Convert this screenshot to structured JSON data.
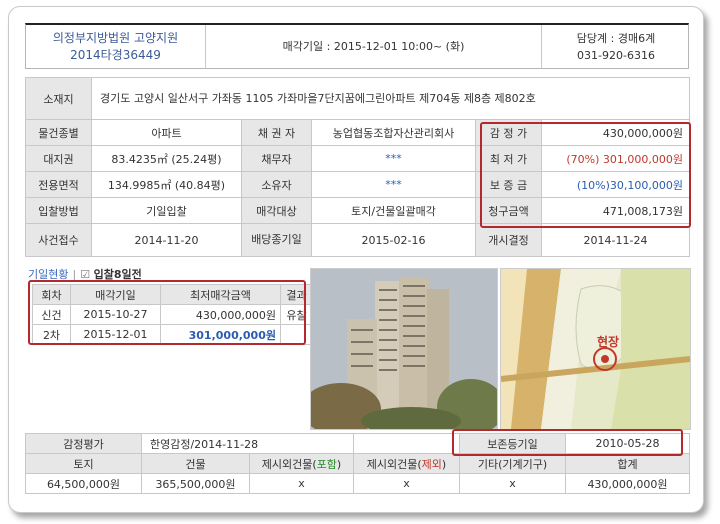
{
  "header": {
    "court_line1": "의정부지방법원 고양지원",
    "court_line2": "2014타경36449",
    "auction_date": "매각기일 : 2015-12-01   10:00~ (화)",
    "dept_line1": "담당계 : 경매6계",
    "dept_line2": "031-920-6316"
  },
  "property": {
    "address_label": "소재지",
    "address": "경기도 고양시 일산서구 가좌동 1105 가좌마을7단지꿈에그린아파트 제704동 제8층 제802호",
    "rows": [
      {
        "l1": "물건종별",
        "v1": "아파트",
        "l2": "채 권 자",
        "v2": "농업협동조합자산관리회사",
        "l3": "감 정 가",
        "v3": "430,000,000원"
      },
      {
        "l1": "대지권",
        "v1": "83.4235㎡ (25.24평)",
        "l2": "채무자",
        "v2": "***",
        "l3": "최 저 가",
        "v3": "(70%) 301,000,000원"
      },
      {
        "l1": "전용면적",
        "v1": "134.9985㎡ (40.84평)",
        "l2": "소유자",
        "v2": "***",
        "l3": "보 증 금",
        "v3": "(10%)30,100,000원"
      },
      {
        "l1": "입찰방법",
        "v1": "기일입찰",
        "l2": "매각대상",
        "v2": "토지/건물일괄매각",
        "l3": "청구금액",
        "v3": "471,008,173원"
      }
    ],
    "case_row": {
      "l1": "사건접수",
      "v1": "2014-11-20",
      "l2": "배당종기일",
      "v2": "2015-02-16",
      "l3": "개시결정",
      "v3": "2014-11-24"
    }
  },
  "status": {
    "label": "기일현황",
    "check": "☑",
    "text": "입찰8일전"
  },
  "history": {
    "headers": [
      "회차",
      "매각기일",
      "최저매각금액",
      "결과"
    ],
    "rows": [
      {
        "round": "신건",
        "date": "2015-10-27",
        "price": "430,000,000원",
        "result": "유찰"
      },
      {
        "round": "2차",
        "date": "2015-12-01",
        "price": "301,000,000원",
        "result": ""
      }
    ]
  },
  "map": {
    "label": "현장"
  },
  "appraisal": {
    "label": "감정평가",
    "value": "한영감정/2014-11-28",
    "reg_label": "보존등기일",
    "reg_value": "2010-05-28",
    "headers": [
      "토지",
      "건물",
      "제시외건물(포함)",
      "제시외건물(제외)",
      "기타(기계기구)",
      "합계"
    ],
    "header_parts": {
      "inc_prefix": "제시외건물(",
      "inc_word": "포함",
      "inc_suffix": ")",
      "exc_prefix": "제시외건물(",
      "exc_word": "제외",
      "exc_suffix": ")"
    },
    "values": [
      "64,500,000원",
      "365,500,000원",
      "x",
      "x",
      "x",
      "430,000,000원"
    ]
  },
  "colors": {
    "highlight_border": "#b2292e",
    "link_blue": "#2a5db0",
    "price_red": "#c0392b",
    "label_bg": "#e7e7e7"
  }
}
